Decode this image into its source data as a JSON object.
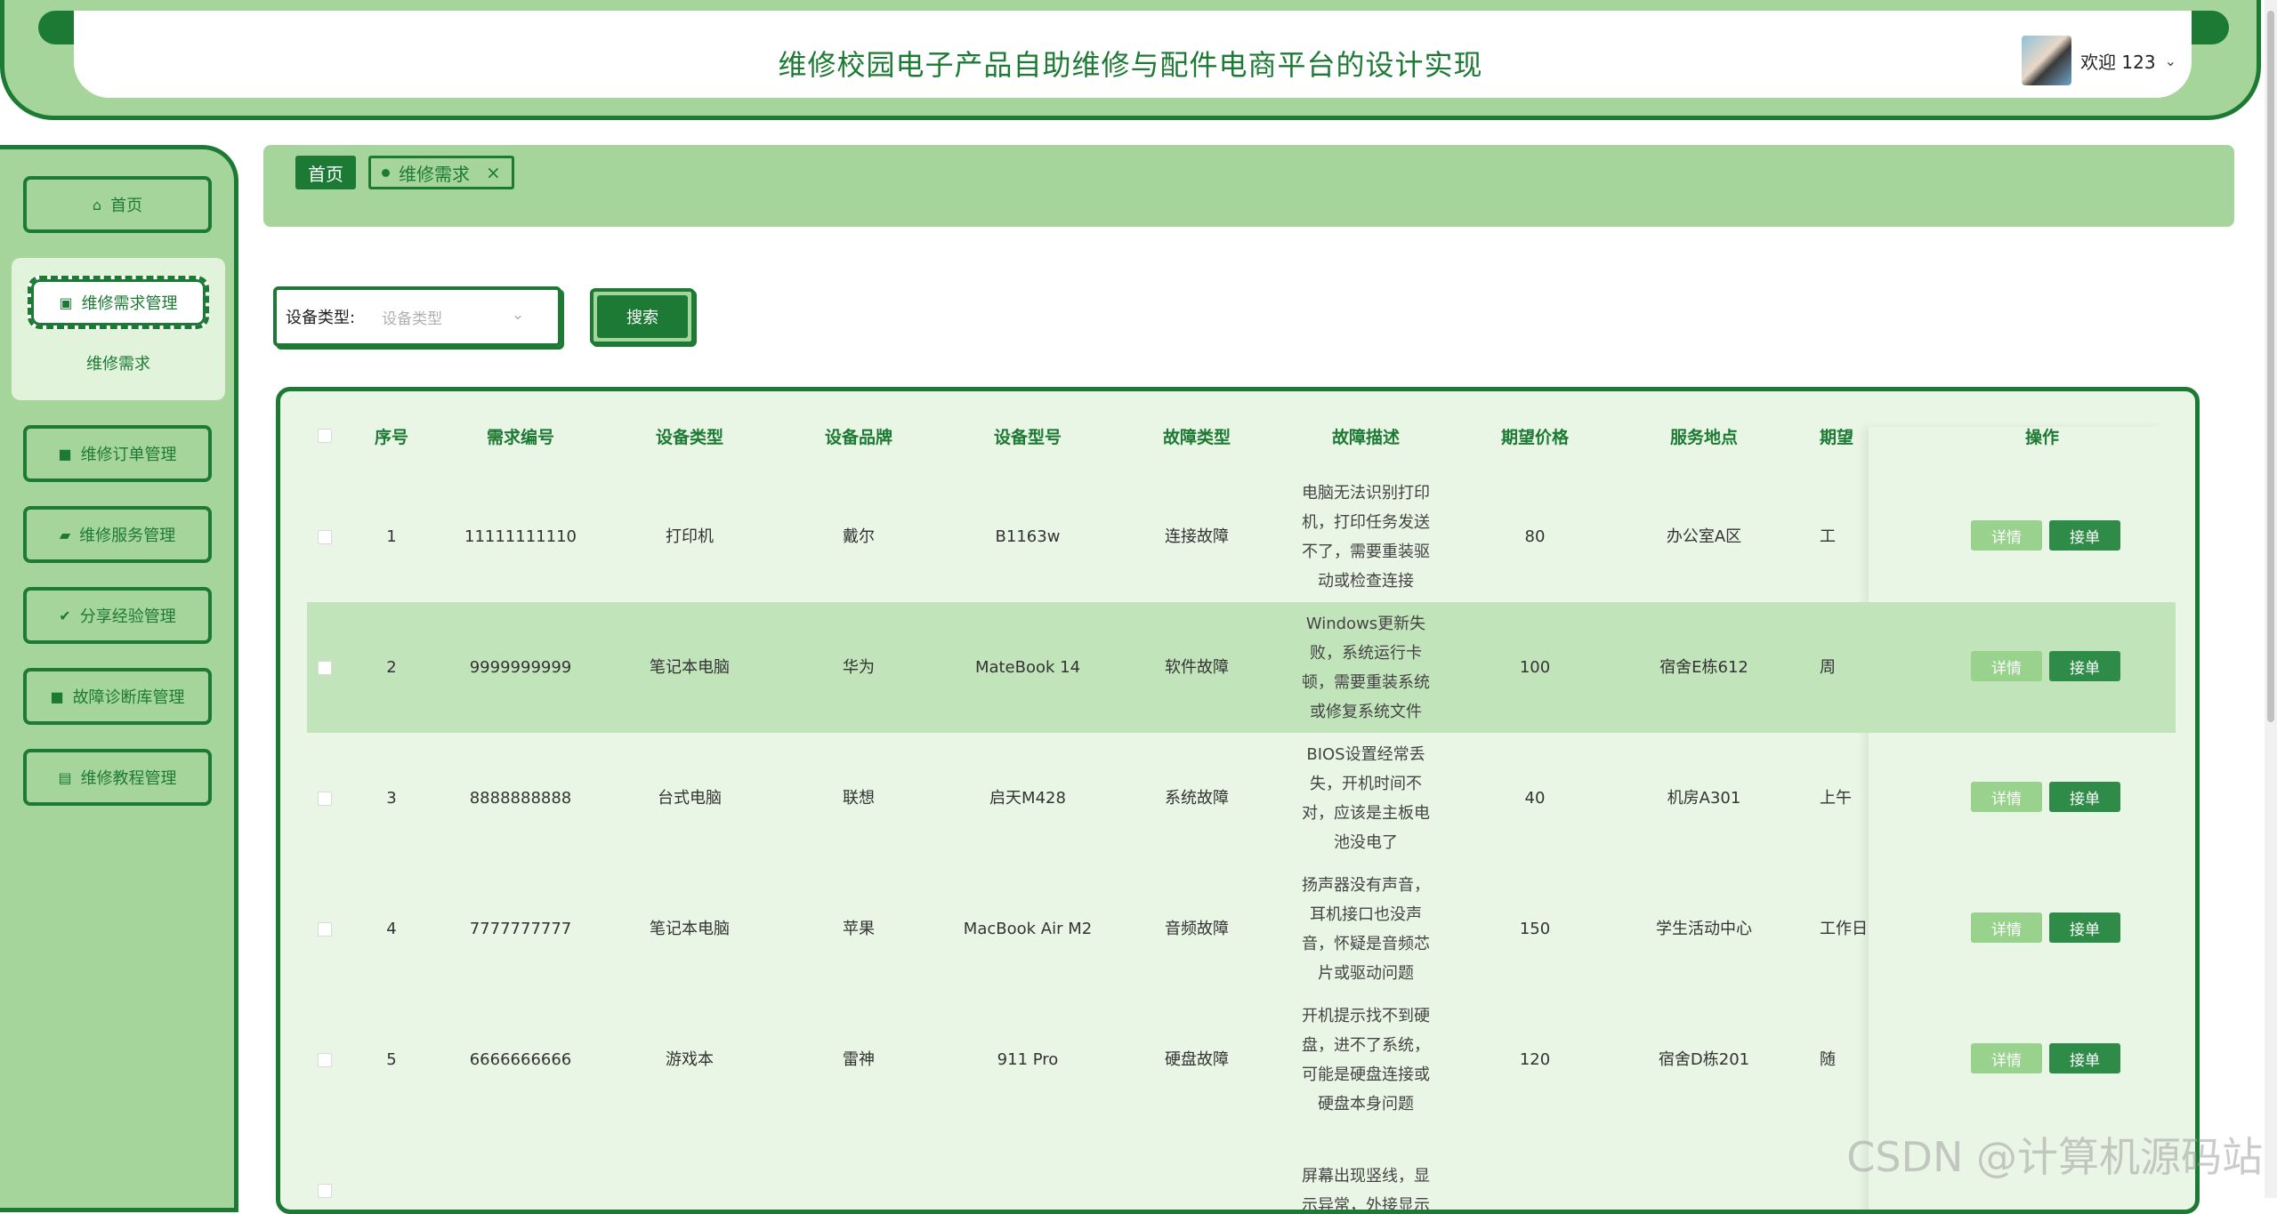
{
  "header": {
    "title": "维修校园电子产品自助维修与配件电商平台的设计实现",
    "welcome": "欢迎 123"
  },
  "sidebar": {
    "items": [
      {
        "label": "首页",
        "icon": "home-icon"
      },
      {
        "label": "维修需求管理",
        "icon": "chip-icon"
      },
      {
        "label": "维修订单管理",
        "icon": "bookmark-icon"
      },
      {
        "label": "维修服务管理",
        "icon": "folder-icon"
      },
      {
        "label": "分享经验管理",
        "icon": "check-circle-icon"
      },
      {
        "label": "故障诊断库管理",
        "icon": "bookmark-icon"
      },
      {
        "label": "维修教程管理",
        "icon": "book-icon"
      }
    ],
    "active_sub": "维修需求"
  },
  "breadcrumb": {
    "home": "首页",
    "current": "维修需求",
    "close": "×"
  },
  "filter": {
    "label": "设备类型:",
    "placeholder": "设备类型",
    "search_button": "搜索"
  },
  "table": {
    "columns": [
      "序号",
      "需求编号",
      "设备类型",
      "设备品牌",
      "设备型号",
      "故障类型",
      "故障描述",
      "期望价格",
      "服务地点",
      "期望",
      "操作"
    ],
    "rows": [
      {
        "idx": "1",
        "code": "11111111110",
        "type": "打印机",
        "brand": "戴尔",
        "model": "B1163w",
        "fault": "连接故障",
        "desc": [
          "电脑无法识别打印",
          "机，打印任务发送",
          "不了，需要重装驱",
          "动或检查连接"
        ],
        "price": "80",
        "place": "办公室A区",
        "expect": "工"
      },
      {
        "idx": "2",
        "code": "9999999999",
        "type": "笔记本电脑",
        "brand": "华为",
        "model": "MateBook 14",
        "fault": "软件故障",
        "desc": [
          "Windows更新失",
          "败，系统运行卡",
          "顿，需要重装系统",
          "或修复系统文件"
        ],
        "price": "100",
        "place": "宿舍E栋612",
        "expect": "周"
      },
      {
        "idx": "3",
        "code": "8888888888",
        "type": "台式电脑",
        "brand": "联想",
        "model": "启天M428",
        "fault": "系统故障",
        "desc": [
          "BIOS设置经常丢",
          "失，开机时间不",
          "对，应该是主板电",
          "池没电了"
        ],
        "price": "40",
        "place": "机房A301",
        "expect": "上午"
      },
      {
        "idx": "4",
        "code": "7777777777",
        "type": "笔记本电脑",
        "brand": "苹果",
        "model": "MacBook Air M2",
        "fault": "音频故障",
        "desc": [
          "扬声器没有声音，",
          "耳机接口也没声",
          "音，怀疑是音频芯",
          "片或驱动问题"
        ],
        "price": "150",
        "place": "学生活动中心",
        "expect": "工作日"
      },
      {
        "idx": "5",
        "code": "6666666666",
        "type": "游戏本",
        "brand": "雷神",
        "model": "911 Pro",
        "fault": "硬盘故障",
        "desc": [
          "开机提示找不到硬",
          "盘，进不了系统，",
          "可能是硬盘连接或",
          "硬盘本身问题"
        ],
        "price": "120",
        "place": "宿舍D栋201",
        "expect": "随"
      },
      {
        "idx": "",
        "code": "",
        "type": "",
        "brand": "",
        "model": "",
        "fault": "",
        "desc": [
          "屏幕出现竖线，显",
          "示异常，外接显示"
        ],
        "price": "",
        "place": "",
        "expect": ""
      }
    ],
    "detail_label": "详情",
    "take_label": "接单"
  },
  "watermark": "CSDN @计算机源码站"
}
